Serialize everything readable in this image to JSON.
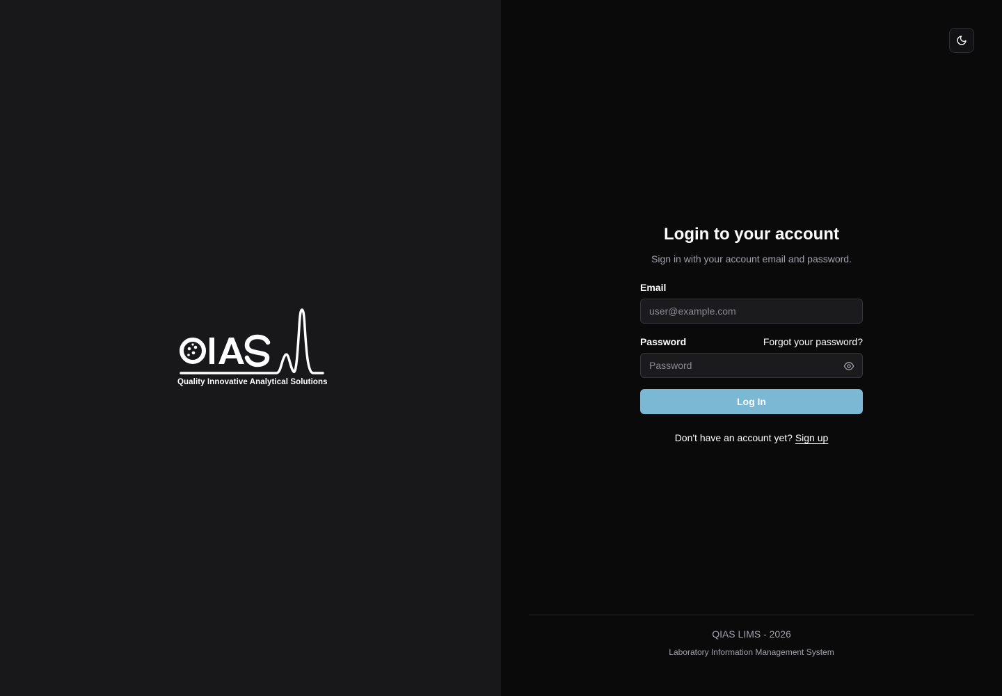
{
  "brand": {
    "logo_text": "QIAS",
    "tagline": "Quality Innovative Analytical Solutions"
  },
  "theme_toggle": {
    "icon": "moon-icon"
  },
  "login": {
    "title": "Login to your account",
    "subtitle": "Sign in with your account email and password.",
    "email_label": "Email",
    "email_placeholder": "user@example.com",
    "password_label": "Password",
    "forgot_label": "Forgot your password?",
    "password_placeholder": "Password",
    "submit_label": "Log In",
    "signup_prompt": "Don't have an account yet?",
    "signup_label": "Sign up"
  },
  "footer": {
    "title": "QIAS LIMS - 2026",
    "subtitle": "Laboratory Information Management System"
  },
  "colors": {
    "brand_panel_bg": "#18181b",
    "auth_panel_bg": "#0a0a0b",
    "primary_button": "#7ab8d4",
    "input_bg": "#1b1b1e",
    "muted_text": "#a1a1aa"
  }
}
